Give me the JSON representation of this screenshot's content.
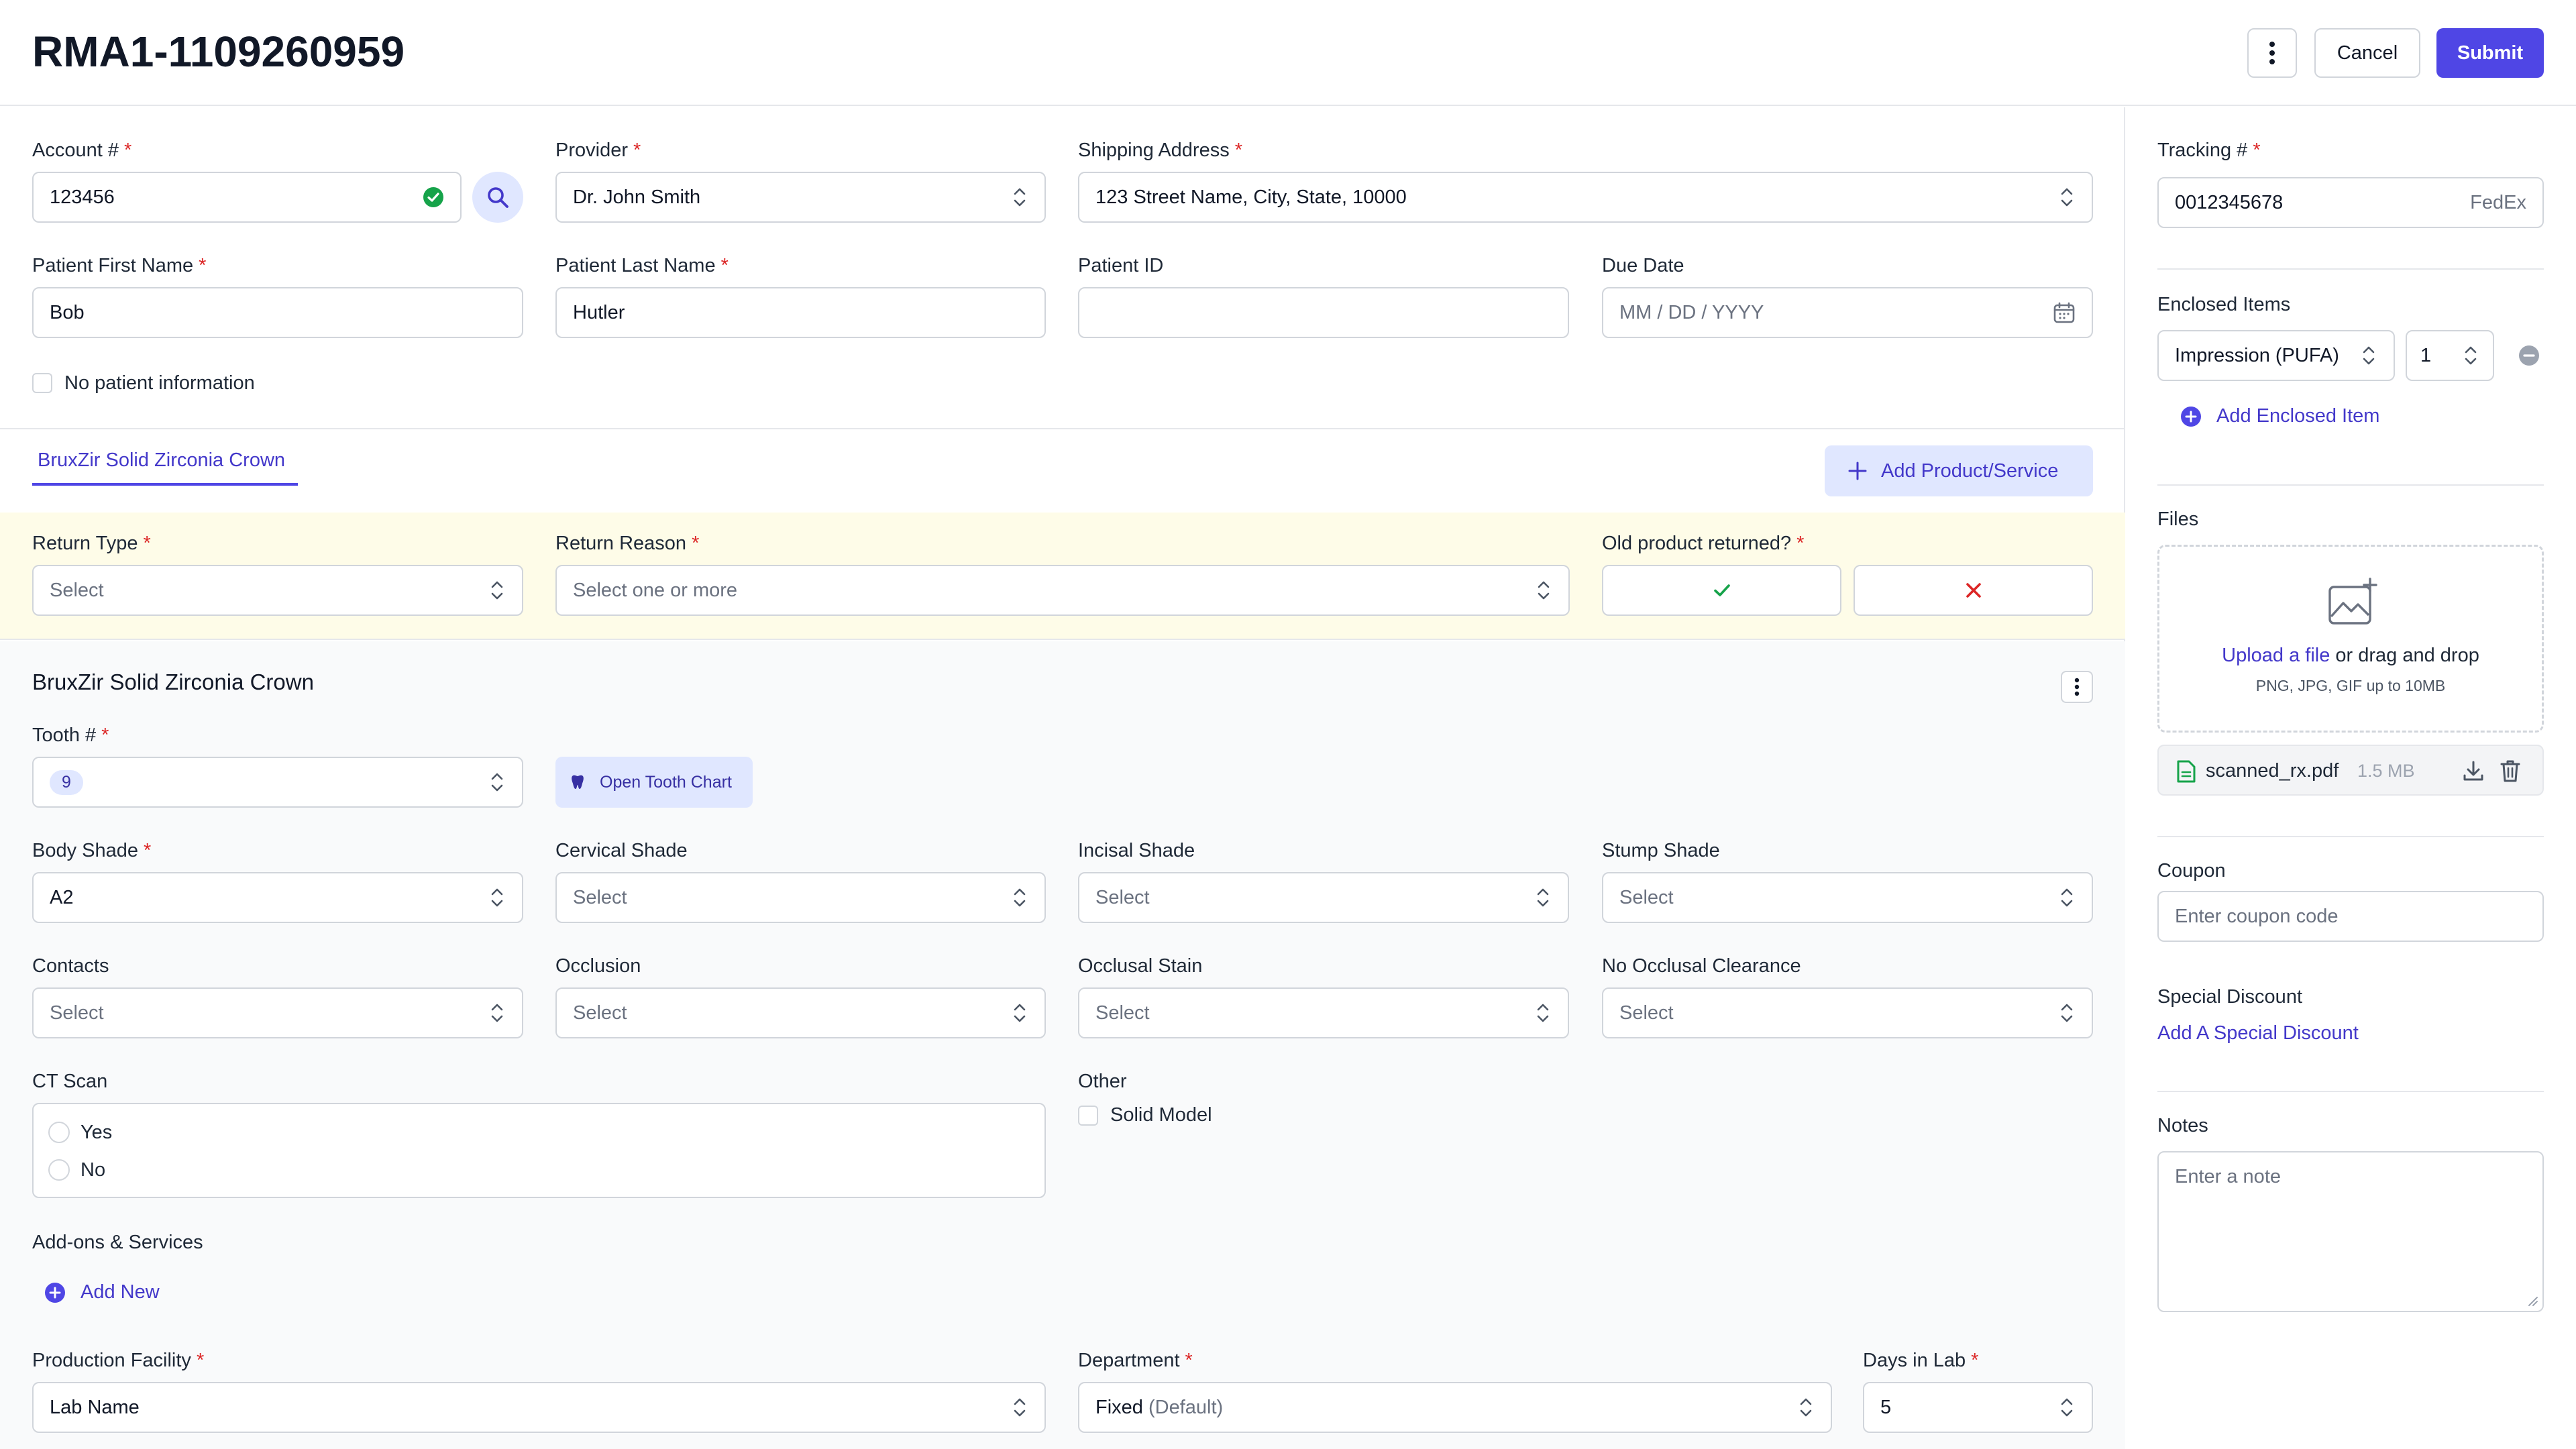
{
  "header": {
    "title": "RMA1-1109260959",
    "cancel_label": "Cancel",
    "submit_label": "Submit"
  },
  "account": {
    "account_label": "Account #",
    "account_value": "123456",
    "provider_label": "Provider",
    "provider_value": "Dr. John Smith",
    "shipping_label": "Shipping Address",
    "shipping_value": "123 Street Name, City, State, 10000",
    "first_name_label": "Patient First Name",
    "first_name_value": "Bob",
    "last_name_label": "Patient Last Name",
    "last_name_value": "Hutler",
    "patient_id_label": "Patient ID",
    "patient_id_value": "",
    "due_date_label": "Due Date",
    "due_date_placeholder": "MM / DD / YYYY",
    "no_patient_label": "No patient information"
  },
  "product_tabs": {
    "active_tab": "BruxZir Solid Zirconia Crown",
    "add_product_label": "Add Product/Service"
  },
  "return": {
    "type_label": "Return Type",
    "type_placeholder": "Select",
    "reason_label": "Return Reason",
    "reason_placeholder": "Select one or more",
    "old_returned_label": "Old product returned?"
  },
  "product": {
    "title": "BruxZir Solid Zirconia Crown",
    "tooth_label": "Tooth #",
    "tooth_value": "9",
    "open_chart_label": "Open Tooth Chart",
    "body_shade_label": "Body Shade",
    "body_shade_value": "A2",
    "cervical_label": "Cervical Shade",
    "incisal_label": "Incisal Shade",
    "stump_label": "Stump Shade",
    "contacts_label": "Contacts",
    "occlusion_label": "Occlusion",
    "occlusal_stain_label": "Occlusal Stain",
    "no_occlusal_label": "No Occlusal Clearance",
    "select_placeholder": "Select",
    "ct_scan_label": "CT Scan",
    "ct_yes": "Yes",
    "ct_no": "No",
    "other_label": "Other",
    "solid_model_label": "Solid Model",
    "addons_label": "Add-ons & Services",
    "add_new_label": "Add New",
    "facility_label": "Production Facility",
    "facility_value": "Lab Name",
    "department_label": "Department",
    "department_value": "Fixed",
    "department_suffix": "(Default)",
    "days_label": "Days in Lab",
    "days_value": "5"
  },
  "sidebar": {
    "tracking_label": "Tracking #",
    "tracking_value": "0012345678",
    "tracking_carrier": "FedEx",
    "enclosed_label": "Enclosed Items",
    "enclosed_item_value": "Impression (PUFA)",
    "enclosed_qty": "1",
    "add_enclosed_label": "Add Enclosed Item",
    "files_label": "Files",
    "upload_link": "Upload a file",
    "upload_rest": "or drag and drop",
    "upload_hint": "PNG, JPG, GIF up to 10MB",
    "file_name": "scanned_rx.pdf",
    "file_size": "1.5 MB",
    "coupon_label": "Coupon",
    "coupon_placeholder": "Enter coupon code",
    "discount_label": "Special Discount",
    "discount_link": "Add A Special Discount",
    "notes_label": "Notes",
    "notes_placeholder": "Enter a note"
  },
  "colors": {
    "primary": "#4f46e5",
    "success": "#16a34a",
    "danger": "#dc2626",
    "highlight_bg": "#fefce8",
    "panel_bg": "#f9fafb"
  }
}
